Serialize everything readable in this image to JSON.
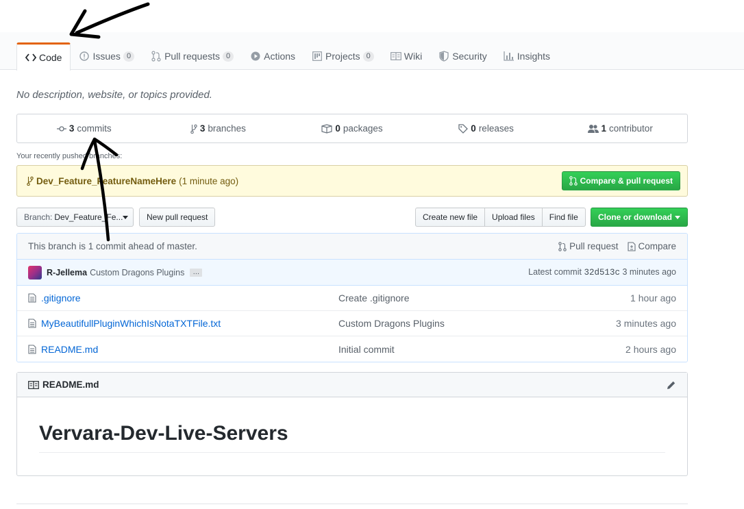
{
  "tabs": [
    {
      "label": "Code",
      "icon": "code-icon",
      "count": null
    },
    {
      "label": "Issues",
      "icon": "issue-opened-icon",
      "count": "0"
    },
    {
      "label": "Pull requests",
      "icon": "git-pull-request-icon",
      "count": "0"
    },
    {
      "label": "Actions",
      "icon": "play-icon",
      "count": null
    },
    {
      "label": "Projects",
      "icon": "project-icon",
      "count": "0"
    },
    {
      "label": "Wiki",
      "icon": "book-icon",
      "count": null
    },
    {
      "label": "Security",
      "icon": "shield-icon",
      "count": null
    },
    {
      "label": "Insights",
      "icon": "graph-icon",
      "count": null
    }
  ],
  "description": "No description, website, or topics provided.",
  "summary": {
    "commits": {
      "num": "3",
      "label": "commits"
    },
    "branches": {
      "num": "3",
      "label": "branches"
    },
    "packages": {
      "num": "0",
      "label": "packages"
    },
    "releases": {
      "num": "0",
      "label": "releases"
    },
    "contributors": {
      "num": "1",
      "label": "contributor"
    }
  },
  "recent": {
    "label": "Your recently pushed branches:",
    "branch": "Dev_Feature_FeatureNameHere",
    "time": "(1 minute ago)",
    "compare_button": "Compare & pull request"
  },
  "toolbar": {
    "branch_prefix": "Branch:",
    "branch_value": "Dev_Feature_Fe...",
    "new_pr": "New pull request",
    "create_file": "Create new file",
    "upload_files": "Upload files",
    "find_file": "Find file",
    "clone": "Clone or download"
  },
  "branch_info": {
    "text": "This branch is 1 commit ahead of master.",
    "pull_request": "Pull request",
    "compare": "Compare"
  },
  "commit": {
    "author": "R-Jellema",
    "message": "Custom Dragons Plugins",
    "ellipsis": "…",
    "latest_label": "Latest commit",
    "sha": "32d513c",
    "age": "3 minutes ago"
  },
  "files": [
    {
      "name": ".gitignore",
      "message": "Create .gitignore",
      "age": "1 hour ago"
    },
    {
      "name": "MyBeautifullPluginWhichIsNotaTXTFile.txt",
      "message": "Custom Dragons Plugins",
      "age": "3 minutes ago"
    },
    {
      "name": "README.md",
      "message": "Initial commit",
      "age": "2 hours ago"
    }
  ],
  "readme": {
    "header": "README.md",
    "title": "Vervara-Dev-Live-Servers"
  },
  "colors": {
    "accent_tab": "#e36209",
    "link": "#0366d6",
    "green_button": "#28a745",
    "annotation": "#000000"
  }
}
